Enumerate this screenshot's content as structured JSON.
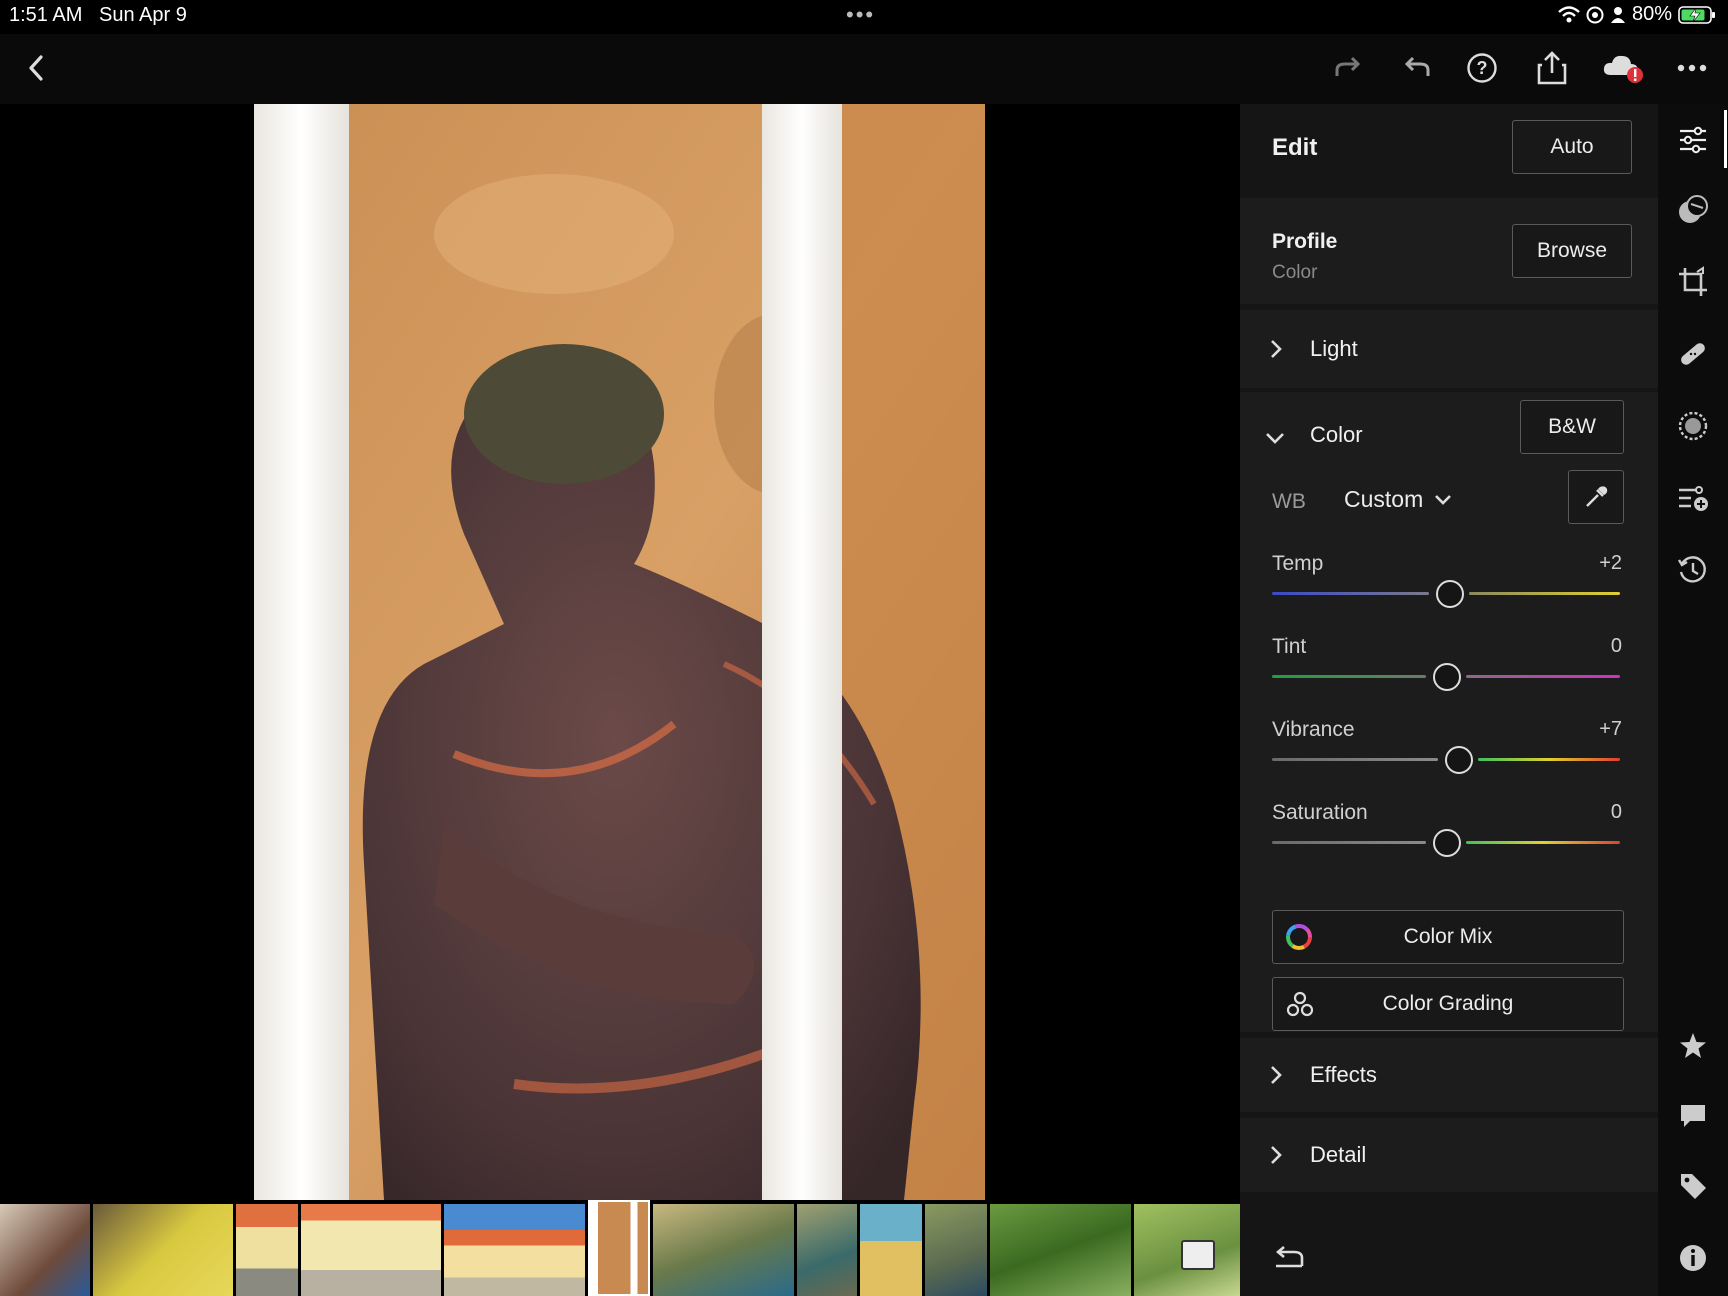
{
  "status_bar": {
    "time": "1:51 AM",
    "date": "Sun Apr 9",
    "battery": "80%",
    "icons": [
      "wifi-icon",
      "location-lock-icon",
      "person-icon",
      "battery-charging-icon"
    ]
  },
  "toolbar": {
    "icons": [
      "back-chevron-icon",
      "redo-icon",
      "undo-icon",
      "help-icon",
      "share-icon",
      "cloud-sync-warning-icon",
      "more-icon"
    ]
  },
  "edit_panel": {
    "title": "Edit",
    "auto_label": "Auto",
    "profile": {
      "label": "Profile",
      "value": "Color",
      "browse_label": "Browse"
    },
    "light_label": "Light",
    "color": {
      "label": "Color",
      "bw_label": "B&W",
      "wb_label": "WB",
      "wb_value": "Custom",
      "sliders": [
        {
          "label": "Temp",
          "value": "+2",
          "position": 0.51
        },
        {
          "label": "Tint",
          "value": "0",
          "position": 0.5
        },
        {
          "label": "Vibrance",
          "value": "+7",
          "position": 0.535
        },
        {
          "label": "Saturation",
          "value": "0",
          "position": 0.5
        }
      ],
      "color_mix_label": "Color Mix",
      "color_grading_label": "Color Grading"
    },
    "effects_label": "Effects",
    "detail_label": "Detail"
  },
  "right_rail": {
    "icons": [
      "adjust-sliders-icon",
      "presets-icon",
      "crop-icon",
      "healing-bandage-icon",
      "masking-icon",
      "versions-icon",
      "history-icon",
      "star-icon",
      "comment-icon",
      "tag-icon",
      "info-icon"
    ]
  },
  "colors": {
    "background": "#000000",
    "panel": "#151515",
    "section": "#1c1c1c",
    "accent_warning": "#e0303a",
    "battery_green": "#4cd964"
  }
}
